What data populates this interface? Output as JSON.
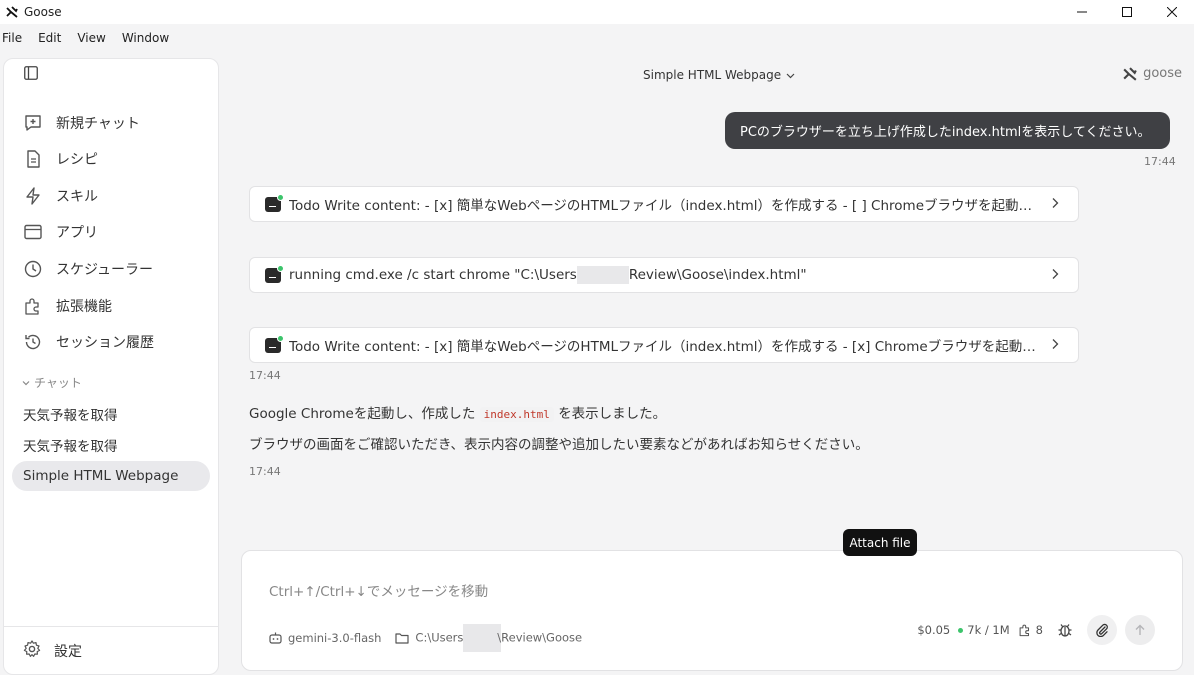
{
  "window": {
    "title": "Goose"
  },
  "menu": [
    "File",
    "Edit",
    "View",
    "Window"
  ],
  "sidebar": {
    "nav": [
      {
        "label": "新規チャット",
        "icon": "new-chat-icon"
      },
      {
        "label": "レシピ",
        "icon": "recipe-icon"
      },
      {
        "label": "スキル",
        "icon": "skills-icon"
      },
      {
        "label": "アプリ",
        "icon": "apps-icon"
      },
      {
        "label": "スケジューラー",
        "icon": "scheduler-icon"
      },
      {
        "label": "拡張機能",
        "icon": "extensions-icon"
      },
      {
        "label": "セッション履歴",
        "icon": "history-icon"
      }
    ],
    "section_label": "チャット",
    "chats": [
      {
        "label": "天気予報を取得",
        "active": false
      },
      {
        "label": "天気予報を取得",
        "active": false
      },
      {
        "label": "Simple HTML Webpage",
        "active": true
      }
    ],
    "settings_label": "設定"
  },
  "header": {
    "session_title": "Simple HTML Webpage",
    "brand": "goose"
  },
  "conversation": {
    "user_message": "PCのブラウザーを立ち上げ作成したindex.htmlを表示してください。",
    "user_time": "17:44",
    "tool_calls": [
      {
        "text": "Todo Write content: - [x] 簡単なWebページのHTMLファイル（index.html）を作成する - [ ] Chromeブラウザを起動してinde..."
      },
      {
        "text_before": "running cmd.exe /c start chrome \"C:\\Users",
        "text_after": "Review\\Goose\\index.html\""
      },
      {
        "text": "Todo Write content: - [x] 簡単なWebページのHTMLファイル（index.html）を作成する - [x] Chromeブラウザを起動してinde..."
      }
    ],
    "tools_time": "17:44",
    "reply_line1_before": "Google Chromeを起動し、作成した",
    "reply_code": "index.html",
    "reply_line1_after": "を表示しました。",
    "reply_line2": "ブラウザの画面をご確認いただき、表示内容の調整や追加したい要素などがあればお知らせください。",
    "reply_time": "17:44"
  },
  "composer": {
    "placeholder": "Ctrl+↑/Ctrl+↓でメッセージを移動",
    "model": "gemini-3.0-flash",
    "path_before": "C:\\Users\\",
    "path_after": "\\Review\\Goose",
    "cost": "$0.05",
    "context": "7k / 1M",
    "extensions_count": "8",
    "tooltip": "Attach file"
  }
}
